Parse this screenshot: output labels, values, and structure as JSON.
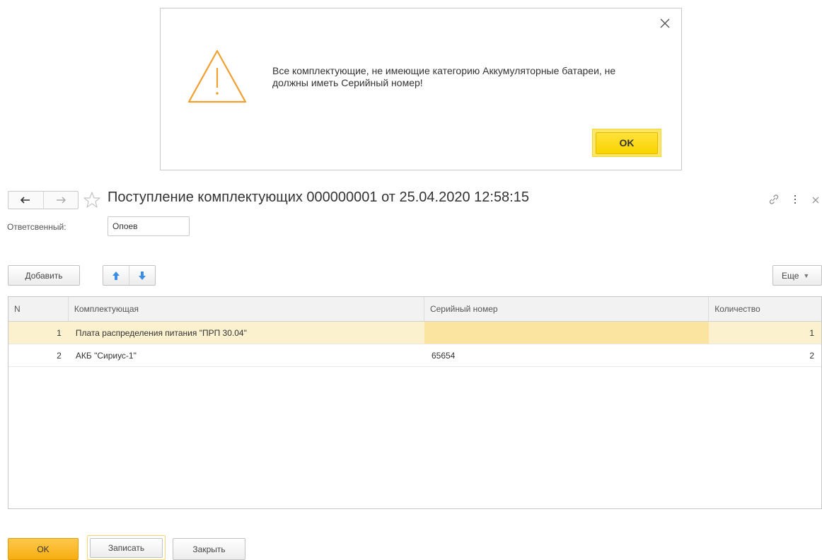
{
  "colors": {
    "warning_icon": "#f0a030",
    "dialog_ok": "#f9d400",
    "primary_ok": "#f7ae12",
    "row_selected": "#fbf1cf",
    "cell_selected": "#fbe3a0",
    "arrow_blue": "#3a8ee6"
  },
  "dialog": {
    "message": "Все комплектующие, не имеющие категорию Аккумуляторные батареи, не должны иметь Серийный номер!",
    "ok_label": "OK",
    "icons": {
      "close": "close-icon",
      "warning": "warning-icon"
    }
  },
  "document": {
    "title": "Поступление комплектующих 000000001 от 25.04.2020 12:58:15",
    "responsible_label": "Ответсвенный:",
    "responsible_value": "Опоев",
    "icons": {
      "back": "arrow-left-icon",
      "forward": "arrow-right-icon",
      "favorite": "star-icon",
      "link": "link-icon",
      "more": "more-vertical-icon",
      "close": "close-icon"
    }
  },
  "toolbar": {
    "add_label": "Добавить",
    "more_label": "Еще",
    "icons": {
      "move_up": "arrow-up-icon",
      "move_down": "arrow-down-icon"
    }
  },
  "table": {
    "columns": [
      "N",
      "Комплектующая",
      "Серийный номер",
      "Количество"
    ],
    "rows": [
      {
        "n": "1",
        "name": "Плата распределения питания \"ПРП 30.04\"",
        "serial": "",
        "qty": "1",
        "selected": true
      },
      {
        "n": "2",
        "name": "АКБ \"Сириус-1\"",
        "serial": "65654",
        "qty": "2",
        "selected": false
      }
    ]
  },
  "footer": {
    "ok_label": "OK",
    "save_label": "Записать",
    "close_label": "Закрыть"
  }
}
